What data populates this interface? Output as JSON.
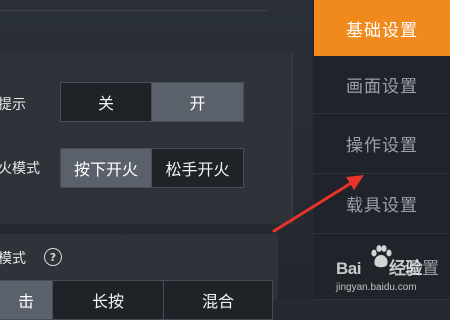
{
  "sidebar": {
    "items": [
      {
        "label": "基础设置",
        "active": true
      },
      {
        "label": "画面设置",
        "active": false
      },
      {
        "label": "操作设置",
        "active": false
      },
      {
        "label": "载具设置",
        "active": false
      },
      {
        "label": "设置",
        "active": false
      }
    ]
  },
  "rows": {
    "row1": {
      "label": "提示",
      "options": [
        "关",
        "开"
      ],
      "selected": "开"
    },
    "row2": {
      "label": "火模式",
      "options": [
        "按下开火",
        "松手开火"
      ],
      "selected": "按下开火"
    },
    "row3": {
      "label": "模式",
      "options": [
        "击",
        "长按",
        "混合"
      ],
      "selected": "击"
    }
  },
  "watermark": {
    "brand_left": "Bai",
    "brand_right": "经验",
    "url": "jingyan.baidu.com"
  },
  "colors": {
    "accent": "#f08a1c",
    "arrow": "#e8332a"
  }
}
